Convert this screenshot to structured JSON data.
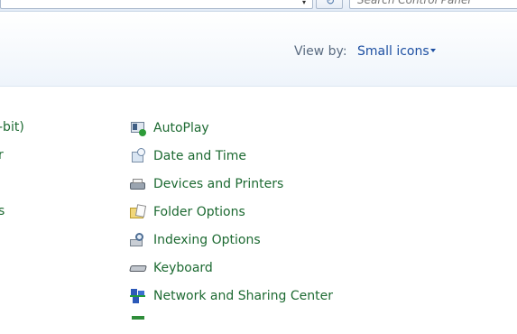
{
  "toolbar": {
    "search_placeholder": "Search Control Panel",
    "address_dropdown_glyph": "▾",
    "refresh_glyph": "↻"
  },
  "header": {
    "view_by_label": "View by:",
    "view_by_value": "Small icons"
  },
  "left_column_fragments": [
    "-bit)",
    "r",
    "",
    "s"
  ],
  "items": [
    {
      "label": "AutoPlay",
      "icon": "autoplay-icon"
    },
    {
      "label": "Date and Time",
      "icon": "date-time-icon"
    },
    {
      "label": "Devices and Printers",
      "icon": "devices-printers-icon"
    },
    {
      "label": "Folder Options",
      "icon": "folder-options-icon"
    },
    {
      "label": "Indexing Options",
      "icon": "indexing-options-icon"
    },
    {
      "label": "Keyboard",
      "icon": "keyboard-icon"
    },
    {
      "label": "Network and Sharing Center",
      "icon": "network-sharing-icon"
    }
  ],
  "colors": {
    "link_green": "#1d6a32",
    "view_by_blue": "#1e50a2",
    "label_gray": "#5a6b80"
  }
}
